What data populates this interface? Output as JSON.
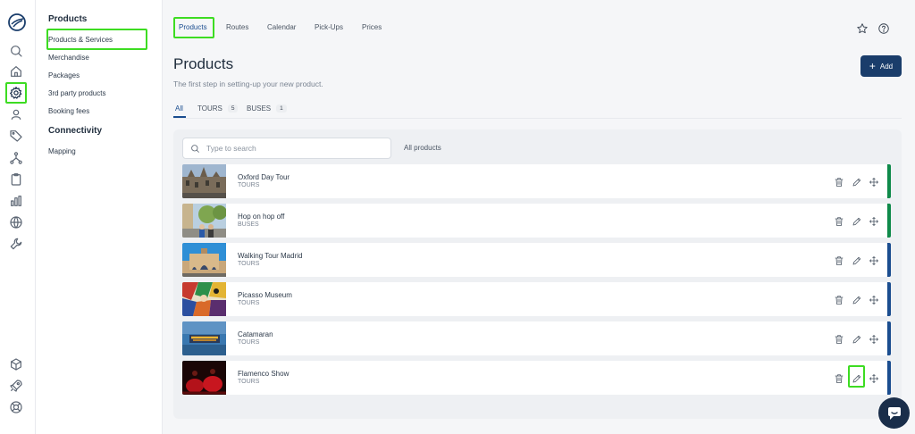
{
  "rail": {
    "icons": [
      "logo-icon",
      "search-icon",
      "home-icon",
      "gear-icon",
      "user-pin-icon",
      "tag-icon",
      "network-icon",
      "clipboard-icon",
      "bar-chart-icon",
      "globe-icon",
      "wrench-icon",
      "box-icon",
      "rocket-icon",
      "lifebuoy-icon"
    ],
    "active": "gear-icon"
  },
  "sidebar": {
    "section_products": "Products",
    "items": [
      "Products & Services",
      "Merchandise",
      "Packages",
      "3rd party products",
      "Booking fees"
    ],
    "section_connectivity": "Connectivity",
    "connectivity_items": [
      "Mapping"
    ]
  },
  "topnav": {
    "tabs": [
      "Products",
      "Routes",
      "Calendar",
      "Pick-Ups",
      "Prices"
    ],
    "active": "Products"
  },
  "header": {
    "title": "Products",
    "subtitle": "The first step in setting-up your new product.",
    "add_label": "Add"
  },
  "filters": {
    "tabs": [
      {
        "label": "All",
        "count": ""
      },
      {
        "label": "TOURS",
        "count": "5"
      },
      {
        "label": "BUSES",
        "count": "1"
      }
    ]
  },
  "search": {
    "placeholder": "Type to search",
    "scope": "All products"
  },
  "products": [
    {
      "name": "Oxford Day Tour",
      "category": "TOURS",
      "accent": "#0f8a4a"
    },
    {
      "name": "Hop on hop off",
      "category": "BUSES",
      "accent": "#0f8a4a"
    },
    {
      "name": "Walking Tour Madrid",
      "category": "TOURS",
      "accent": "#1a4d8f"
    },
    {
      "name": "Picasso Museum",
      "category": "TOURS",
      "accent": "#1a4d8f"
    },
    {
      "name": "Catamaran",
      "category": "TOURS",
      "accent": "#1a4d8f"
    },
    {
      "name": "Flamenco Show",
      "category": "TOURS",
      "accent": "#1a4d8f"
    }
  ],
  "colors": {
    "primary": "#1a3d6b",
    "highlight": "#3ddc22"
  }
}
